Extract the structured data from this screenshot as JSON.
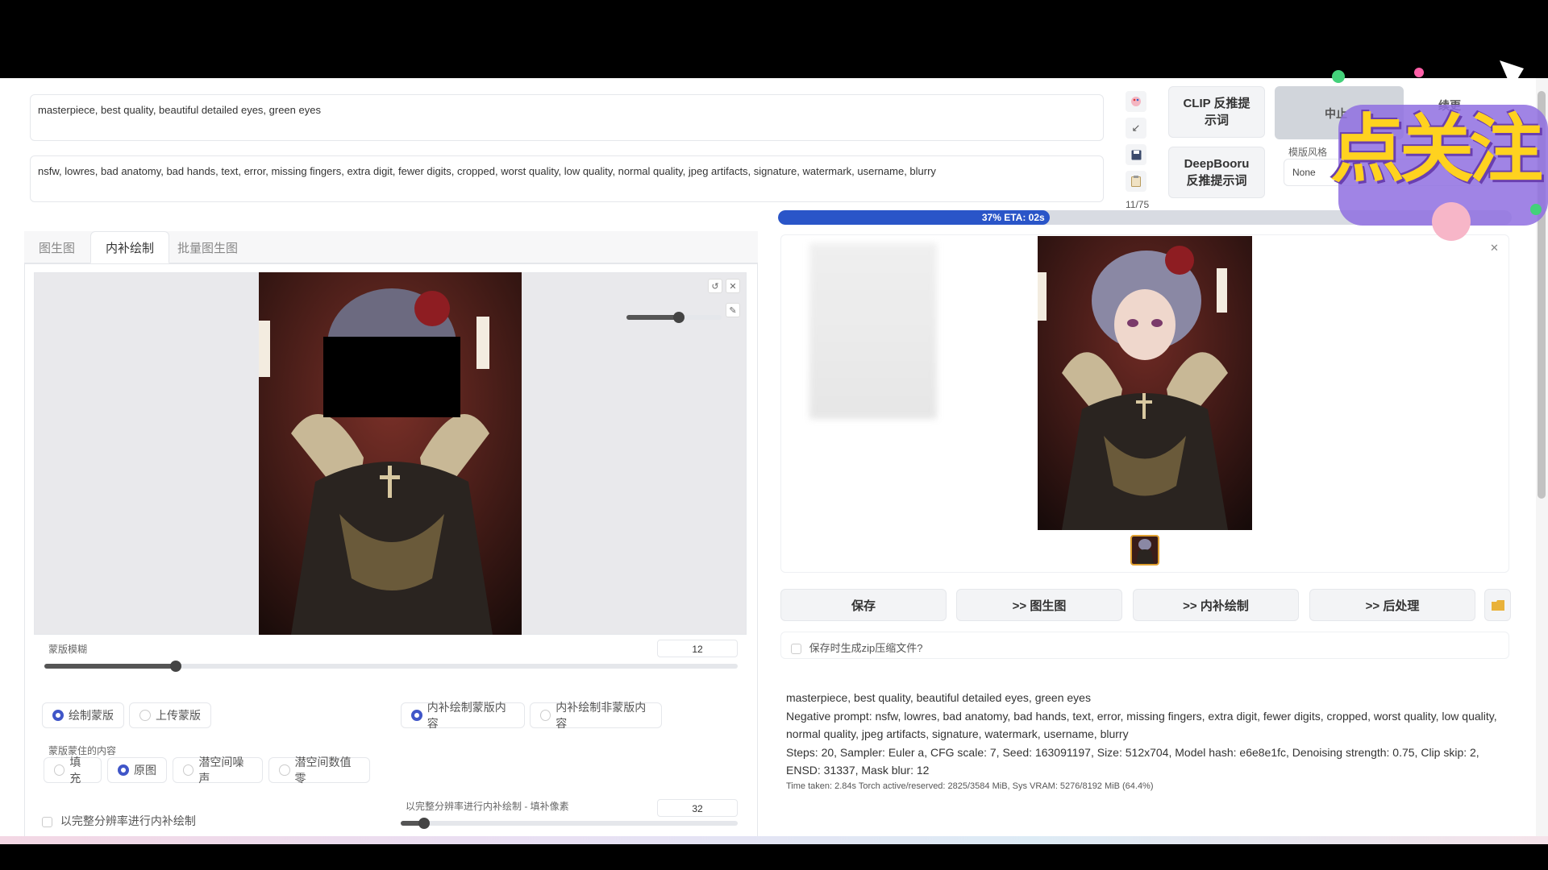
{
  "prompts": {
    "positive": "masterpiece, best quality, beautiful detailed eyes, green eyes",
    "negative": "nsfw, lowres, bad anatomy, bad hands, text, error, missing fingers, extra digit, fewer digits, cropped, worst quality, low quality, normal quality, jpeg artifacts, signature, watermark, username, blurry",
    "token_count": "11/75"
  },
  "toolbar": {
    "interrogate_clip": "CLIP 反推提示词",
    "interrogate_clip_l1": "CLIP 反推提",
    "interrogate_clip_l2": "示词",
    "interrogate_deepbooru_l1": "DeepBooru",
    "interrogate_deepbooru_l2": "反推提示词",
    "generate_partial": "中止",
    "skip_partial": "续更",
    "styles_label": "模版风格",
    "styles_value": "None"
  },
  "tabs": [
    {
      "label": "图生图"
    },
    {
      "label": "内补绘制"
    },
    {
      "label": "批量图生图"
    }
  ],
  "mask_blur": {
    "label": "蒙版模糊",
    "value": "12",
    "fraction": 0.19
  },
  "brush_size_fraction": 0.55,
  "mask_mode": {
    "options": [
      "绘制蒙版",
      "上传蒙版"
    ],
    "selected": "绘制蒙版"
  },
  "inpaint_area_mode": {
    "options": [
      "内补绘制蒙版内容",
      "内补绘制非蒙版内容"
    ],
    "selected": "内补绘制蒙版内容"
  },
  "masked_content": {
    "label": "蒙版蒙住的内容",
    "options": [
      "填充",
      "原图",
      "潜空间噪声",
      "潜空间数值零"
    ],
    "selected": "原图"
  },
  "full_res": {
    "label": "以完整分辨率进行内补绘制",
    "padding_label": "以完整分辨率进行内补绘制 - 填补像素",
    "padding_value": "32",
    "padding_fraction": 0.07
  },
  "progress": {
    "text": "37% ETA: 02s",
    "fraction": 0.37
  },
  "actions": {
    "save": "保存",
    "to_img2img": ">> 图生图",
    "to_inpaint": ">> 内补绘制",
    "to_extras": ">> 后处理"
  },
  "zip_option": "保存时生成zip压缩文件?",
  "generation_info": {
    "prompt": "masterpiece, best quality, beautiful detailed eyes, green eyes",
    "negative": "Negative prompt: nsfw, lowres, bad anatomy, bad hands, text, error, missing fingers, extra digit, fewer digits, cropped, worst quality, low quality, normal quality, jpeg artifacts, signature, watermark, username, blurry",
    "params": "Steps: 20, Sampler: Euler a, CFG scale: 7, Seed: 163091197, Size: 512x704, Model hash: e6e8e1fc, Denoising strength: 0.75, Clip skip: 2, ENSD: 31337, Mask blur: 12",
    "timing": "Time taken: 2.84s  Torch active/reserved: 2825/3584 MiB, Sys VRAM: 5276/8192 MiB (64.4%)"
  },
  "sticker_text": "点关注",
  "icons": {
    "paint": "palette-icon",
    "arrow": "arrow-icon",
    "save": "floppy-icon",
    "clipboard": "clipboard-icon",
    "undo": "undo-icon",
    "close": "close-icon",
    "brush": "brush-icon",
    "folder": "folder-icon"
  },
  "colors": {
    "accent": "#2a55c8",
    "radio_on": "#4056c8"
  }
}
